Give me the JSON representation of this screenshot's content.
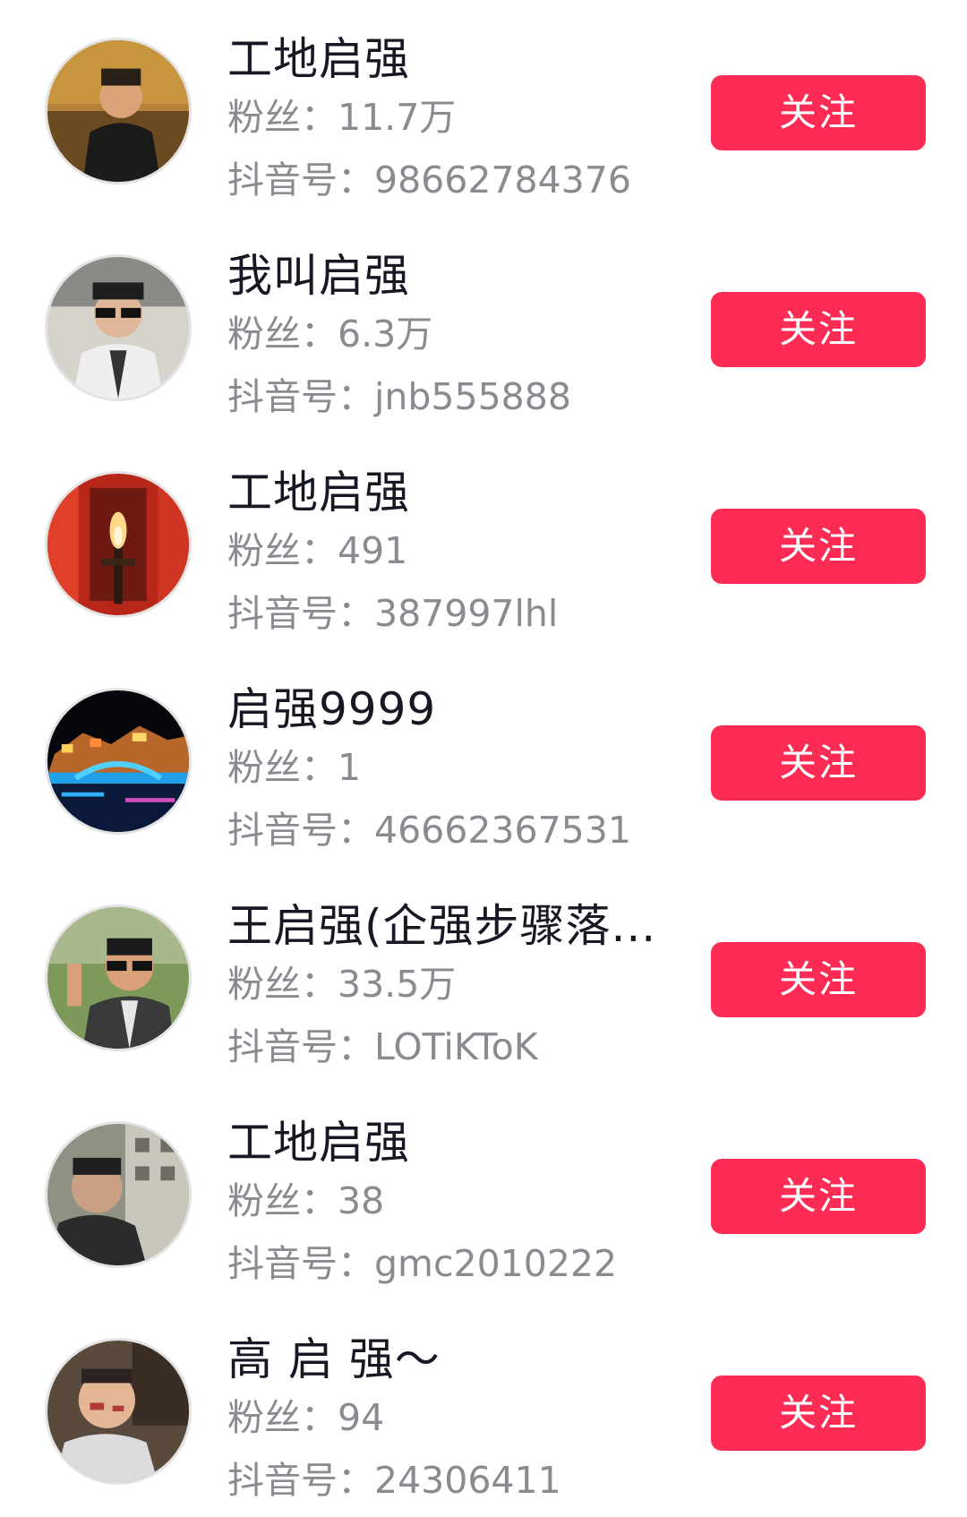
{
  "labels": {
    "fans_prefix": "粉丝：",
    "douyin_id_prefix": "抖音号："
  },
  "accent_color": "#fe2c55",
  "users": [
    {
      "name": "工地启强",
      "fans": "11.7万",
      "douyin_id": "98662784376",
      "follow_label": "关注"
    },
    {
      "name": "我叫启强",
      "fans": "6.3万",
      "douyin_id": "jnb555888",
      "follow_label": "关注"
    },
    {
      "name": "工地启强",
      "fans": "491",
      "douyin_id": "387997lhl",
      "follow_label": "关注"
    },
    {
      "name": "启强9999",
      "fans": "1",
      "douyin_id": "46662367531",
      "follow_label": "关注"
    },
    {
      "name": "王启强(企强步骤落...",
      "fans": "33.5万",
      "douyin_id": "LOTiKToK",
      "follow_label": "关注"
    },
    {
      "name": "工地启强",
      "fans": "38",
      "douyin_id": "gmc2010222",
      "follow_label": "关注"
    },
    {
      "name": "高 启 强～",
      "fans": "94",
      "douyin_id": "24306411",
      "follow_label": "关注"
    }
  ]
}
